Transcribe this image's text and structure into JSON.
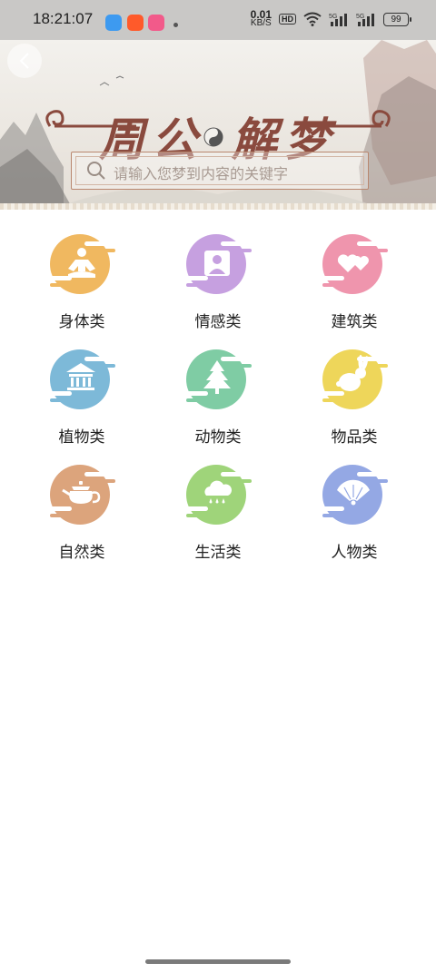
{
  "status_bar": {
    "time": "18:21:07",
    "speed_value": "0.01",
    "speed_unit": "KB/S",
    "hd_label": "HD",
    "signal_1": "5G",
    "signal_2": "5G",
    "battery": "99"
  },
  "banner": {
    "title_left": "周公",
    "title_right": "解梦"
  },
  "search": {
    "placeholder": "请输入您梦到内容的关键字"
  },
  "categories": [
    {
      "label": "身体类",
      "icon": "meditation-person-icon",
      "color": "#f0b860"
    },
    {
      "label": "情感类",
      "icon": "person-icon",
      "color": "#c6a0e0"
    },
    {
      "label": "建筑类",
      "icon": "hearts-icon",
      "color": "#ef95ad"
    },
    {
      "label": "植物类",
      "icon": "temple-icon",
      "color": "#7db9d8"
    },
    {
      "label": "动物类",
      "icon": "pine-tree-icon",
      "color": "#7fcca4"
    },
    {
      "label": "物品类",
      "icon": "rabbit-icon",
      "color": "#eed65a"
    },
    {
      "label": "自然类",
      "icon": "teapot-icon",
      "color": "#dca47c"
    },
    {
      "label": "生活类",
      "icon": "rain-cloud-icon",
      "color": "#9fd47a"
    },
    {
      "label": "人物类",
      "icon": "fan-icon",
      "color": "#94a8e4"
    }
  ]
}
